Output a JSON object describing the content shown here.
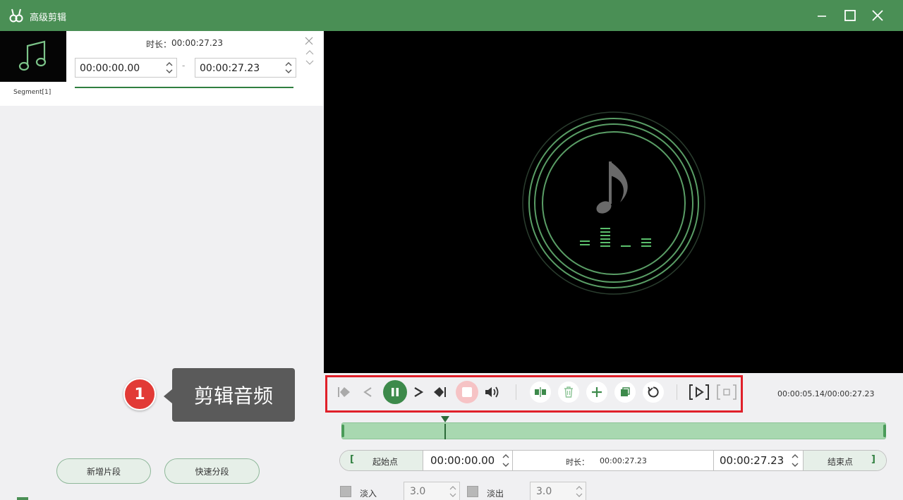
{
  "window": {
    "title": "高级剪辑",
    "title_bar_color": "#4a8f55"
  },
  "segment_panel": {
    "segment_name": "Segment[1]",
    "duration_label": "时长：",
    "duration_value": "00:00:27.23",
    "start_time": "00:00:00.00",
    "end_time": "00:00:27.23",
    "separator": "-"
  },
  "left_buttons": {
    "add_segment": "新增片段",
    "quick_split": "快速分段"
  },
  "callout": {
    "number": "1",
    "text": "剪辑音频",
    "badge_color": "#e23a36"
  },
  "player": {
    "time_readout": "00:00:05.14/00:00:27.23",
    "accent_color": "#3d8a4b",
    "highlight_color": "#e0202a"
  },
  "range": {
    "start_button": "起始点",
    "end_button": "结束点",
    "start_time": "00:00:00.00",
    "end_time": "00:00:27.23",
    "duration_label": "时长：",
    "duration_value": "00:00:27.23",
    "left_bracket": "[",
    "right_bracket": "]"
  },
  "fade": {
    "fade_in_label": "淡入",
    "fade_in_value": "3.0",
    "fade_out_label": "淡出",
    "fade_out_value": "3.0"
  },
  "timeline": {
    "playhead_fraction": 0.19
  },
  "icons": [
    "app-logo-icon",
    "minimize-icon",
    "maximize-icon",
    "close-icon",
    "music-note-icon",
    "jump-to-start-icon",
    "prev-frame-icon",
    "pause-icon",
    "next-frame-icon",
    "jump-to-end-icon",
    "stop-icon",
    "volume-icon",
    "split-icon",
    "delete-icon",
    "add-icon",
    "copy-icon",
    "rotate-icon",
    "preview-icon",
    "fullscreen-icon"
  ]
}
